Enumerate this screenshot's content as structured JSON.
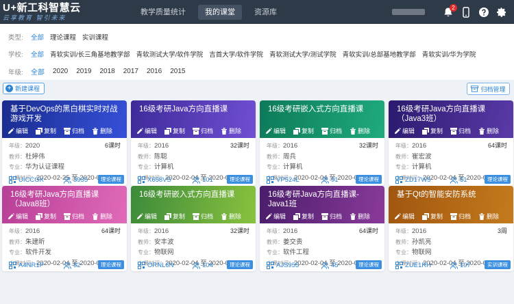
{
  "header": {
    "logo_main": "U+新工科智慧云",
    "logo_sub": "云享教育 智引未来",
    "nav": [
      {
        "label": "教学质量统计",
        "active": false
      },
      {
        "label": "我的课堂",
        "active": true
      },
      {
        "label": "资源库",
        "active": false
      }
    ],
    "notification_count": "2"
  },
  "filters": {
    "type": {
      "label": "类型:",
      "options": [
        "全部",
        "理论课程",
        "实训课程"
      ],
      "selected": 0
    },
    "school": {
      "label": "学校:",
      "options": [
        "全部",
        "青软实训/长三角基地教学部",
        "青软测试大学/软件学院",
        "吉首大学/软件学院",
        "青软测试大学/测试学院",
        "青软实训/总部基地教学部",
        "青软实训/华为学院"
      ],
      "selected": 0
    },
    "year": {
      "label": "年级:",
      "options": [
        "全部",
        "2020",
        "2019",
        "2018",
        "2017",
        "2016",
        "2015"
      ],
      "selected": 0
    }
  },
  "toolbar": {
    "new_course": "新建课程",
    "archive_manage": "归档管理"
  },
  "labels": {
    "edit": "编辑",
    "copy": "复制",
    "archive": "归档",
    "delete": "删除",
    "year": "年级：",
    "teacher": "教师：",
    "major": "专业：",
    "time": "上课时间："
  },
  "courses": [
    {
      "title": "基于DevOps的黑白棋实时对战游戏开发",
      "year": "2020",
      "hours": "6课时",
      "teacher": "杜婷伟",
      "major": "华为认证课程",
      "time": "2020-02-25 至 2020-02-29",
      "code": "UICCGK",
      "count": "3935",
      "tag": "理论课程",
      "color_from": "#1a2c8f",
      "color_to": "#3550d8"
    },
    {
      "title": "16级考研Java方向直播课",
      "year": "2016",
      "hours": "32课时",
      "teacher": "陈聪",
      "major": "计算机",
      "time": "2020-02-04 至 2020-03-31",
      "code": "X658VS",
      "count": "101",
      "tag": "理论课程",
      "color_from": "#3f2a9a",
      "color_to": "#6f4fd2"
    },
    {
      "title": "16级考研嵌入式方向直播课",
      "year": "2016",
      "hours": "32课时",
      "teacher": "周兵",
      "major": "计算机",
      "time": "2020-02-04 至 2020-03-31",
      "code": "VP524L",
      "count": "91",
      "tag": "理论课程",
      "color_from": "#0d7a5a",
      "color_to": "#1faa7e"
    },
    {
      "title": "16级考研Java方向直播课（Java3班）",
      "year": "2016",
      "hours": "64课时",
      "teacher": "崔宏波",
      "major": "计算机",
      "time": "2020-02-04 至 2020-03-31",
      "code": "ZD17W5",
      "count": "51",
      "tag": "理论课程",
      "color_from": "#2b1a6e",
      "color_to": "#5a3aa8"
    },
    {
      "title": "16级考研Java方向直播课（Java8班）",
      "year": "2016",
      "hours": "64课时",
      "teacher": "朱建昕",
      "major": "软件开发",
      "time": "2020-02-04 至 2020-03-31",
      "code": "A4NR1P",
      "count": "82",
      "tag": "理论课程",
      "color_from": "#b83f97",
      "color_to": "#e06ab8"
    },
    {
      "title": "16级考研嵌入式方向直播课",
      "year": "2016",
      "hours": "32课时",
      "teacher": "安丰波",
      "major": "物联网",
      "time": "2020-02-04 至 2020-03-31",
      "code": "ORNL6N",
      "count": "104",
      "tag": "理论课程",
      "color_from": "#3c8a3a",
      "color_to": "#8ac23f"
    },
    {
      "title": "16级考研Java方向直播课-Java1班",
      "year": "2016",
      "hours": "64课时",
      "teacher": "姜交贵",
      "major": "软件工程",
      "time": "2020-02-04 至 2020-03-31",
      "code": "AJS955",
      "count": "45",
      "tag": "理论课程",
      "color_from": "#4a1d6b",
      "color_to": "#8a3a9a"
    },
    {
      "title": "基于Qt的智能安防系统",
      "year": "2016",
      "hours": "3周",
      "teacher": "孙凯亮",
      "major": "物联网",
      "time": "2020-02-04 至 2020-02-24",
      "code": "ZUE1RH",
      "count": "197",
      "tag": "实训课程",
      "color_from": "#a0560f",
      "color_to": "#c47a1c"
    }
  ]
}
